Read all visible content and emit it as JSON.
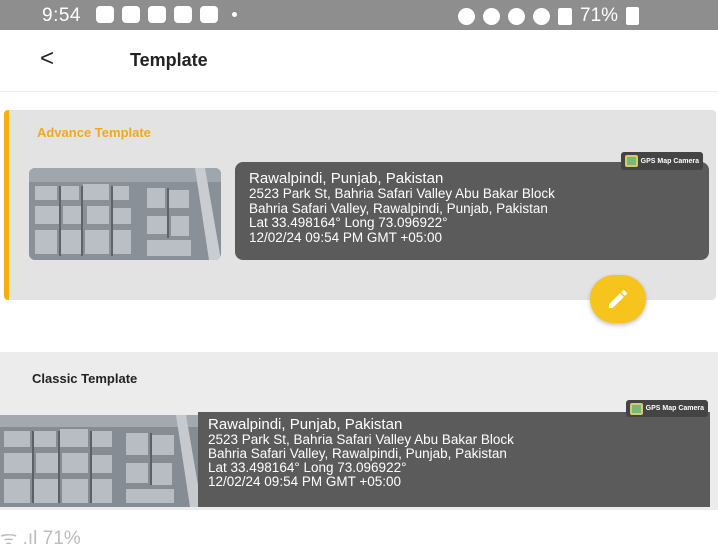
{
  "status_bar": {
    "time": "9:54",
    "battery": "71%",
    "left_icons": [
      "facebook-icon",
      "youtube-icon",
      "tiktok-icon",
      "tiktok-icon",
      "shopping-bag-icon",
      "dot-icon"
    ],
    "right_icons": [
      "camera-icon",
      "alarm-icon",
      "location-icon",
      "wifi-icon",
      "signal-icon",
      "battery-icon"
    ]
  },
  "header": {
    "back_icon": "back-arrow-icon",
    "back_glyph": "<",
    "title": "Template"
  },
  "advance_template": {
    "label": "Advance Template",
    "badge": "GPS Map Camera",
    "line1": "Rawalpindi, Punjab, Pakistan",
    "line2": "2523 Park St, Bahria Safari Valley Abu Bakar Block",
    "line3": "Bahria Safari Valley, Rawalpindi, Punjab, Pakistan",
    "line4": "Lat 33.498164° Long 73.096922°",
    "line5": "12/02/24 09:54 PM GMT +05:00",
    "edit_icon": "pencil-icon"
  },
  "classic_template": {
    "label": "Classic Template",
    "badge": "GPS Map Camera",
    "line1": "Rawalpindi, Punjab, Pakistan",
    "line2": "2523 Park St, Bahria Safari Valley Abu Bakar Block",
    "line3": "Bahria Safari Valley, Rawalpindi, Punjab, Pakistan",
    "line4": "Lat 33.498164° Long 73.096922°",
    "line5": "12/02/24 09:54 PM GMT +05:00"
  },
  "overlay_fragment": {
    "text": "ᯤ .ıl 71%"
  },
  "colors": {
    "accent": "#f3b20a",
    "label_orange": "#f2a81a",
    "fab": "#f6c41c",
    "info_box": "#5b5b5b",
    "status_bar": "#8e8e8e"
  }
}
